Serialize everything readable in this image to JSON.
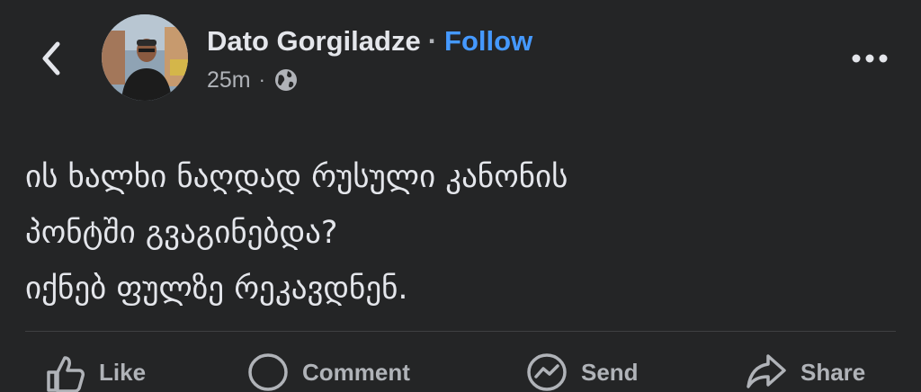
{
  "header": {
    "back_icon": "chevron-left-icon",
    "author_name": "Dato Gorgiladze",
    "separator": "·",
    "follow_label": "Follow",
    "timestamp": "25m",
    "meta_separator": "·",
    "audience_icon": "globe-icon",
    "more_icon": "more-horizontal-icon"
  },
  "post": {
    "lines": [
      "ის ხალხი ნაღდად რუსული კანონის",
      "პონტში გვაგინებდა?",
      "იქნებ ფულზე რეკავდნენ."
    ]
  },
  "actions": {
    "like_label": "Like",
    "comment_label": "Comment",
    "send_label": "Send",
    "share_label": "Share"
  },
  "colors": {
    "background": "#242526",
    "text_primary": "#e4e6eb",
    "text_secondary": "#b0b3b8",
    "accent": "#4599ff"
  }
}
